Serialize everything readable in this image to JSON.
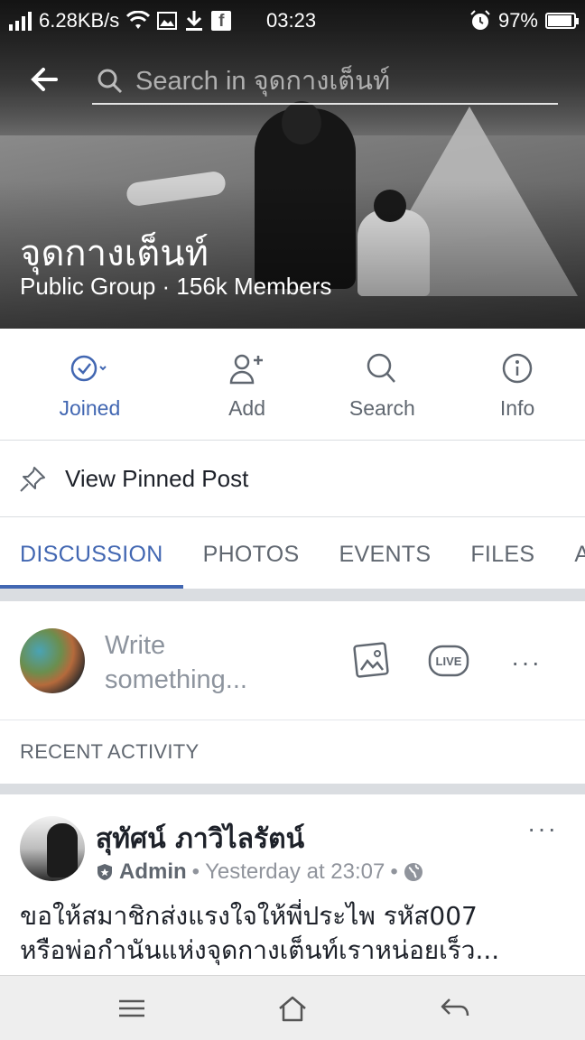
{
  "status_bar": {
    "speed": "6.28KB/s",
    "time": "03:23",
    "battery": "97%",
    "battery_level": 0.97,
    "icons": [
      "signal-icon",
      "wifi-icon",
      "image-icon",
      "download-icon",
      "facebook-icon",
      "alarm-icon",
      "battery-icon"
    ]
  },
  "header": {
    "search_placeholder": "Search in จุดกางเต็นท์"
  },
  "group": {
    "name": "จุดกางเต็นท์",
    "subtitle": "Public Group · 156k Members"
  },
  "actions": [
    {
      "label": "Joined",
      "icon": "check-circle-icon",
      "active": true
    },
    {
      "label": "Add",
      "icon": "add-person-icon",
      "active": false
    },
    {
      "label": "Search",
      "icon": "search-icon",
      "active": false
    },
    {
      "label": "Info",
      "icon": "info-icon",
      "active": false
    }
  ],
  "pinned": {
    "label": "View Pinned Post"
  },
  "tabs": [
    {
      "label": "DISCUSSION",
      "active": true
    },
    {
      "label": "PHOTOS",
      "active": false
    },
    {
      "label": "EVENTS",
      "active": false
    },
    {
      "label": "FILES",
      "active": false
    },
    {
      "label": "A",
      "active": false
    }
  ],
  "composer": {
    "placeholder": "Write something...",
    "live_label": "LIVE",
    "more": "···"
  },
  "recent_activity": "RECENT ACTIVITY",
  "post": {
    "author": "สุทัศน์ ภาวิไลรัตน์",
    "role": "Admin",
    "time": "Yesterday at 23:07",
    "separator": "•",
    "text_line1": "ขอให้สมาชิกส่งแรงใจให้พี่ประไพ รหัส007",
    "text_line2": "หรือพ่อกำนันแห่งจุดกางเต็นท์เราหน่อยเร็ว...",
    "more": "···"
  },
  "colors": {
    "accent": "#4267b2",
    "secondary_text": "#606770",
    "divider": "#dadde1"
  }
}
